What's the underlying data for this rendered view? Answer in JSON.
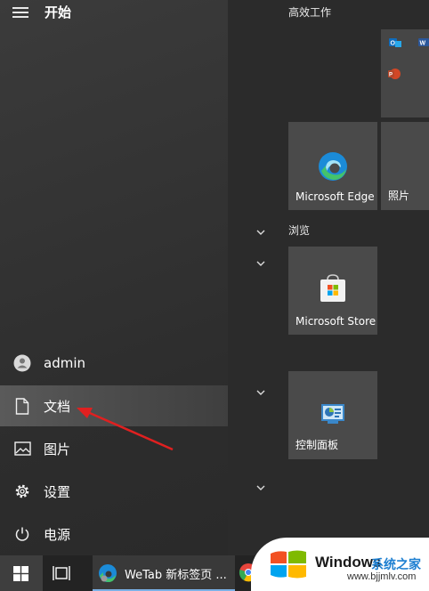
{
  "start_menu": {
    "title": "开始",
    "nav": {
      "user": "admin",
      "documents": "文档",
      "pictures": "图片",
      "settings": "设置",
      "power": "电源"
    }
  },
  "tiles": {
    "group_productivity": "高效工作",
    "group_browse": "浏览",
    "edge_label": "Microsoft Edge",
    "photos_label": "照片",
    "store_label": "Microsoft Store",
    "control_panel_label": "控制面板"
  },
  "taskbar": {
    "app_label": "WeTab 新标签页 ..."
  },
  "watermark": {
    "brand": "Windows",
    "brand_suffix": "系统之家",
    "url": "www.bjjmlv.com"
  },
  "colors": {
    "accent_arrow": "#e02020",
    "edge_blue": "#1b8bd8",
    "edge_green": "#44c36b",
    "outlook_blue": "#0f6cbd",
    "word_blue": "#2b579a",
    "powerpoint_red": "#d24726"
  }
}
